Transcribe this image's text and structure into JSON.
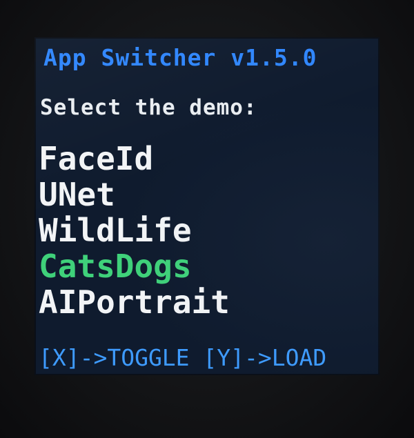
{
  "app": {
    "title": "App Switcher v1.5.0",
    "prompt": "Select the demo:"
  },
  "menu": {
    "items": [
      {
        "label": "FaceId",
        "selected": false
      },
      {
        "label": "UNet",
        "selected": false
      },
      {
        "label": "WildLife",
        "selected": false
      },
      {
        "label": "CatsDogs",
        "selected": true
      },
      {
        "label": "AIPortrait",
        "selected": false
      }
    ]
  },
  "footer": {
    "toggle_hint": "[X]->TOGGLE",
    "load_hint": "[Y]->LOAD"
  },
  "colors": {
    "screen_background": "#0f1b2e",
    "title": "#2f86ff",
    "text": "#f2f4f6",
    "selected": "#3fd17a",
    "footer": "#3e9bff"
  }
}
